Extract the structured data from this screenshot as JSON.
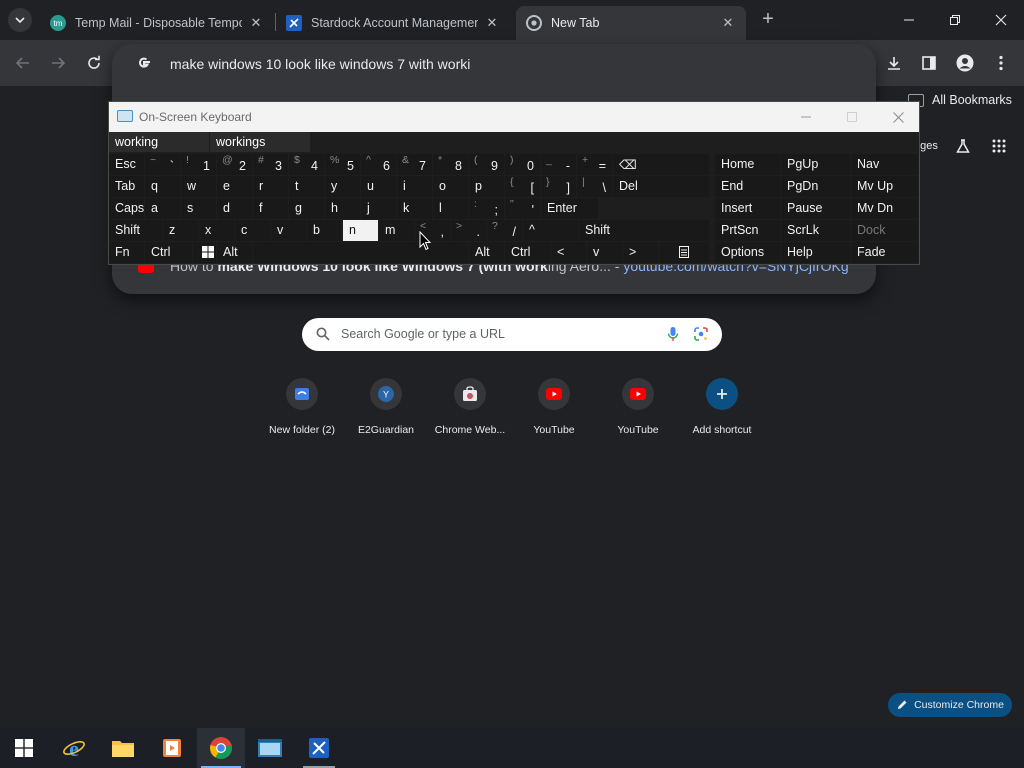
{
  "tabs": [
    {
      "title": "Temp Mail - Disposable Tempo",
      "icon": "temp-mail-icon",
      "color": "#2b9b8f"
    },
    {
      "title": "Stardock Account Managemen",
      "icon": "stardock-icon",
      "color": "#1f5fbf"
    },
    {
      "title": "New Tab",
      "icon": "chrome-icon",
      "active": true
    }
  ],
  "omnibox": {
    "query": "make windows 10 look like windows 7 with worki",
    "suggestion": {
      "prefix": "How to ",
      "bold": "make Windows 10 look like Windows 7 (with work",
      "rest": "ing Aero...",
      "sep": " - ",
      "url": "youtube.com/watch?v=SNYjCjIrOKg"
    }
  },
  "bookmarks": {
    "all_label": "All Bookmarks",
    "partial_label": "ges"
  },
  "osk": {
    "title": "On-Screen Keyboard",
    "predictions": [
      "working",
      "workings"
    ],
    "rows": [
      [
        {
          "l": "Esc"
        },
        {
          "s": "~",
          "l": "`"
        },
        {
          "s": "!",
          "l": "1"
        },
        {
          "s": "@",
          "l": "2"
        },
        {
          "s": "#",
          "l": "3"
        },
        {
          "s": "$",
          "l": "4"
        },
        {
          "s": "%",
          "l": "5"
        },
        {
          "s": "^",
          "l": "6"
        },
        {
          "s": "&",
          "l": "7"
        },
        {
          "s": "*",
          "l": "8"
        },
        {
          "s": "(",
          "l": "9"
        },
        {
          "s": ")",
          "l": "0"
        },
        {
          "s": "_",
          "l": "-"
        },
        {
          "s": "+",
          "l": "="
        },
        {
          "l": "⌫"
        }
      ],
      [
        {
          "l": "Tab"
        },
        {
          "l": "q"
        },
        {
          "l": "w"
        },
        {
          "l": "e"
        },
        {
          "l": "r"
        },
        {
          "l": "t"
        },
        {
          "l": "y"
        },
        {
          "l": "u"
        },
        {
          "l": "i"
        },
        {
          "l": "o"
        },
        {
          "l": "p"
        },
        {
          "s": "{",
          "l": "["
        },
        {
          "s": "}",
          "l": "]"
        },
        {
          "s": "|",
          "l": "\\"
        },
        {
          "l": "Del"
        }
      ],
      [
        {
          "l": "Caps"
        },
        {
          "l": "a"
        },
        {
          "l": "s"
        },
        {
          "l": "d"
        },
        {
          "l": "f"
        },
        {
          "l": "g"
        },
        {
          "l": "h"
        },
        {
          "l": "j"
        },
        {
          "l": "k"
        },
        {
          "l": "l"
        },
        {
          "s": ":",
          "l": ";"
        },
        {
          "s": "\"",
          "l": "'"
        },
        {
          "l": "Enter"
        }
      ],
      [
        {
          "l": "Shift"
        },
        {
          "l": "z"
        },
        {
          "l": "x"
        },
        {
          "l": "c"
        },
        {
          "l": "v"
        },
        {
          "l": "b"
        },
        {
          "l": "n"
        },
        {
          "l": "m"
        },
        {
          "s": "<",
          "l": ","
        },
        {
          "s": ">",
          "l": "."
        },
        {
          "s": "?",
          "l": "/"
        },
        {
          "l": "^"
        },
        {
          "l": "Shift"
        }
      ],
      [
        {
          "l": "Fn"
        },
        {
          "l": "Ctrl"
        },
        {
          "l": "win-logo"
        },
        {
          "l": "Alt"
        },
        {
          "l": ""
        },
        {
          "l": "Alt"
        },
        {
          "l": "Ctrl"
        },
        {
          "l": "<"
        },
        {
          "l": "v"
        },
        {
          "l": ">"
        },
        {
          "l": "menu-icon"
        }
      ]
    ],
    "side": [
      [
        "Home",
        "PgUp",
        "Nav"
      ],
      [
        "End",
        "PgDn",
        "Mv Up"
      ],
      [
        "Insert",
        "Pause",
        "Mv Dn"
      ],
      [
        "PrtScn",
        "ScrLk",
        "Dock"
      ],
      [
        "Options",
        "Help",
        "Fade"
      ]
    ],
    "highlighted_key": "n"
  },
  "ntp": {
    "search_placeholder": "Search Google or type a URL",
    "shortcuts": [
      {
        "name": "New folder (2)",
        "icon": "folder-blue-icon"
      },
      {
        "name": "E2Guardian",
        "icon": "e2guardian-icon"
      },
      {
        "name": "Chrome Web...",
        "icon": "chrome-web-store-icon"
      },
      {
        "name": "YouTube",
        "icon": "youtube-icon"
      },
      {
        "name": "YouTube",
        "icon": "youtube-icon"
      },
      {
        "name": "Add shortcut",
        "icon": "plus-icon"
      }
    ],
    "customize_label": "Customize Chrome"
  },
  "taskbar": {
    "apps": [
      "start-icon",
      "internet-explorer-icon",
      "file-explorer-icon",
      "media-player-icon",
      "chrome-icon",
      "terminal-icon",
      "stardock-app-icon"
    ],
    "active": "chrome-icon"
  },
  "colors": {
    "bg": "#202124",
    "toolbar": "#35363a",
    "accent": "#8ab4f8",
    "osk_bg": "#1e1e1e",
    "key_highlight": "#f2f2f2",
    "youtube": "#ff0000"
  }
}
